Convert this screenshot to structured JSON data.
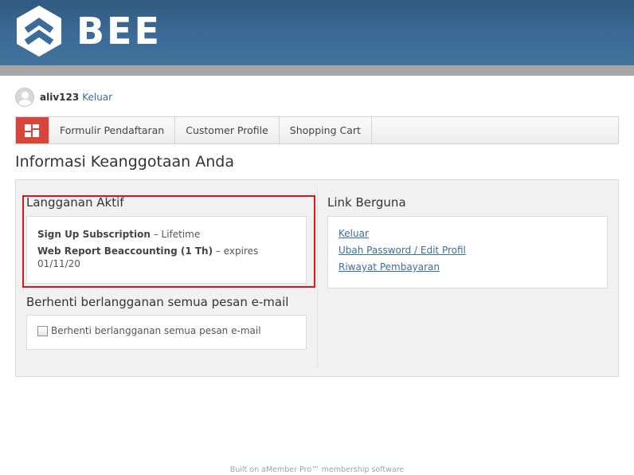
{
  "header": {
    "logo_text": "BEE"
  },
  "user": {
    "username": "aliv123",
    "logout_label": "Keluar"
  },
  "menu": {
    "items": [
      "Formulir Pendaftaran",
      "Customer Profile",
      "Shopping Cart"
    ]
  },
  "page_title": "Informasi Keanggotaan Anda",
  "subscriptions": {
    "title": "Langganan Aktif",
    "items": [
      {
        "name": "Sign Up Subscription",
        "detail": "– Lifetime"
      },
      {
        "name": "Web Report Beaccounting (1 Th)",
        "detail": "– expires",
        "date": "01/11/20"
      }
    ]
  },
  "unsubscribe": {
    "title": "Berhenti berlangganan semua pesan e-mail",
    "checkbox_label": "Berhenti berlangganan semua pesan e-mail",
    "checked": false
  },
  "links": {
    "title": "Link Berguna",
    "items": [
      "Keluar",
      "Ubah Password / Edit Profil",
      "Riwayat Pembayaran"
    ]
  },
  "footer": {
    "prefix": "Built on",
    "link_text": "aMember Pro™ membership software"
  },
  "colors": {
    "header": "#3c6d98",
    "accent": "#d8453a",
    "link": "#3a6f9a",
    "highlight": "#e0151c"
  }
}
